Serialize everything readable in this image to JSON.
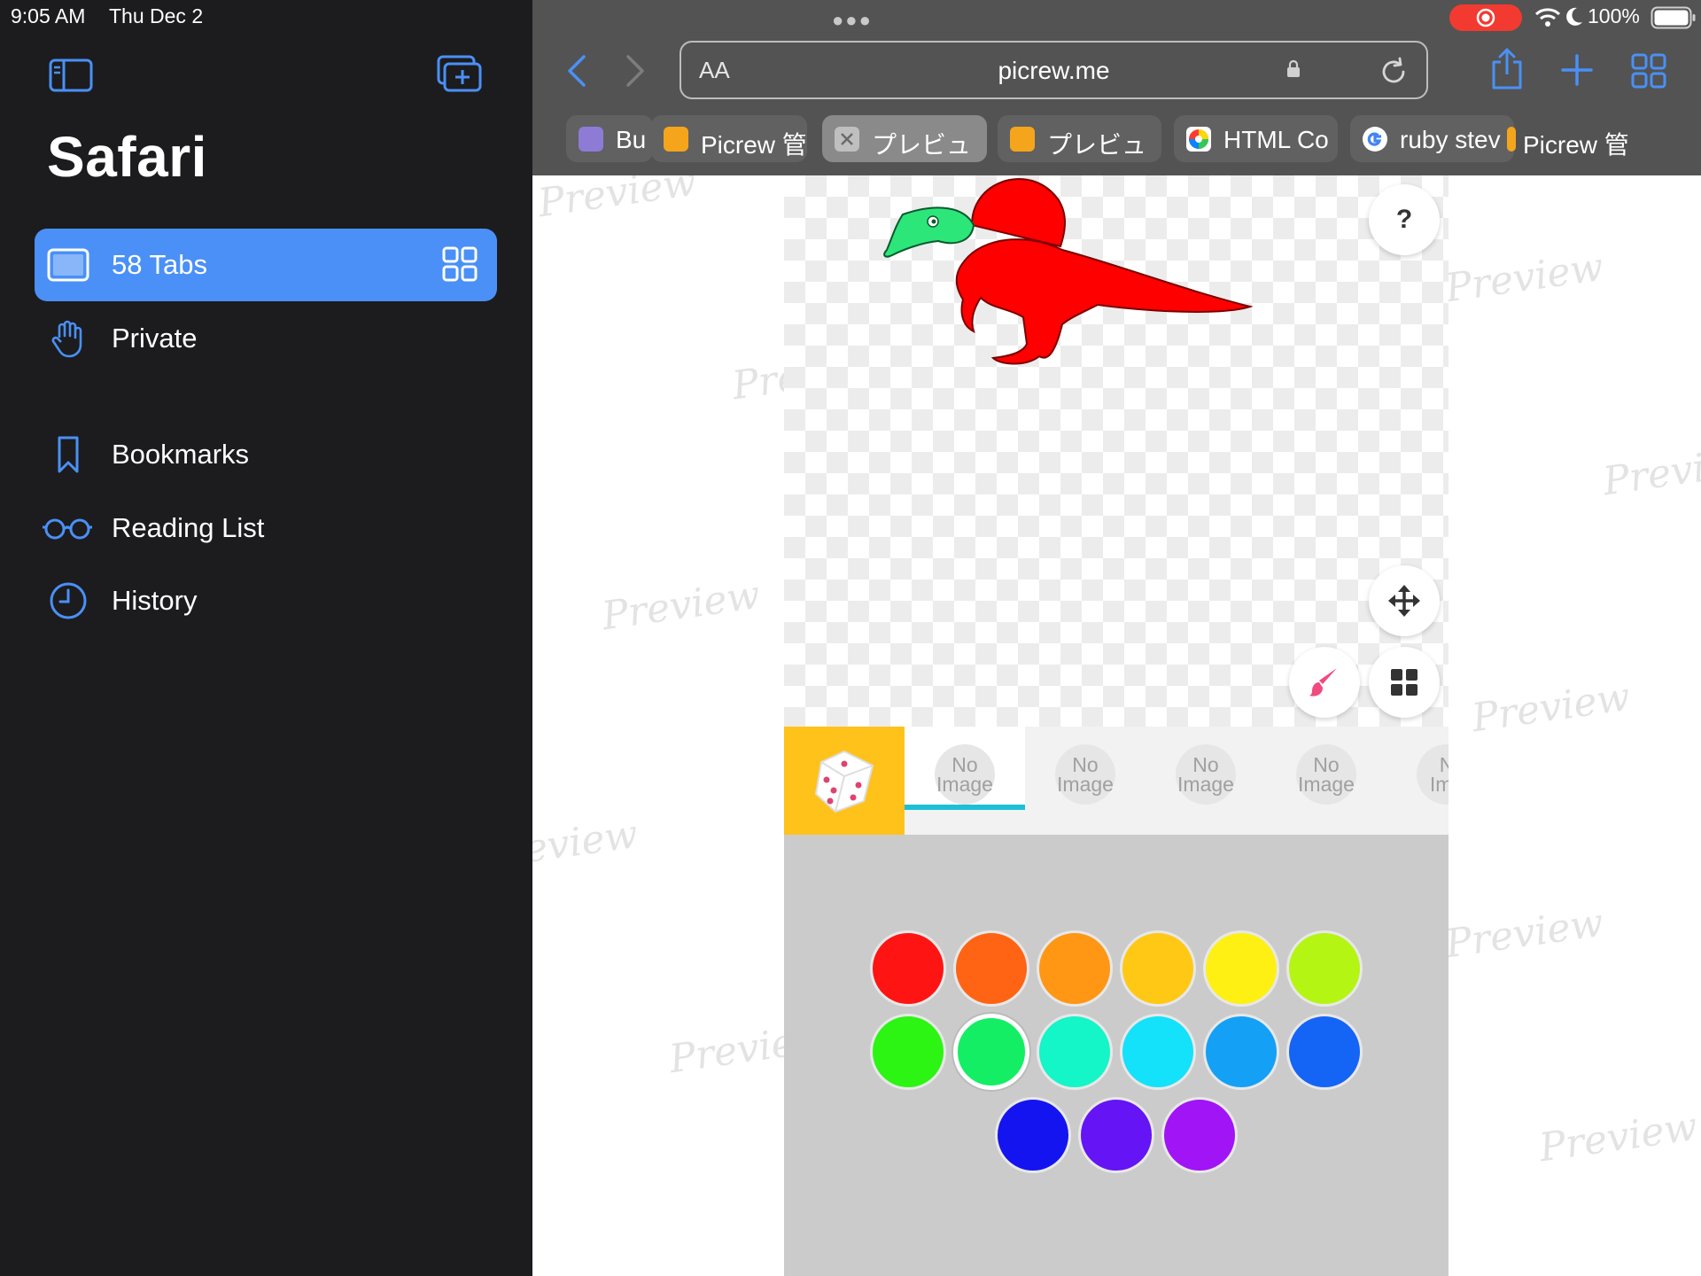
{
  "status_bar": {
    "time": "9:05 AM",
    "date": "Thu Dec 2",
    "battery": "100%"
  },
  "sidebar": {
    "title": "Safari",
    "items": [
      {
        "label": "58 Tabs",
        "active": true
      },
      {
        "label": "Private"
      },
      {
        "label": "Bookmarks"
      },
      {
        "label": "Reading List"
      },
      {
        "label": "History"
      }
    ]
  },
  "toolbar": {
    "aa_label": "AA",
    "url": "picrew.me"
  },
  "tabs": [
    {
      "label": "Bu",
      "favicon_color": "#8d7bd6"
    },
    {
      "label": "Picrew 管",
      "favicon_color": "#f5a51c"
    },
    {
      "label": "プレビュ",
      "favicon_color": "#bfbfbf",
      "active": true
    },
    {
      "label": "プレビュ",
      "favicon_color": "#f5a51c"
    },
    {
      "label": "HTML Co",
      "favicon_color": "#ffffff"
    },
    {
      "label": "ruby stev",
      "favicon_color": "#ffffff"
    },
    {
      "label": "Picrew 管",
      "favicon_color": "#f5a51c"
    }
  ],
  "watermark": "Preview",
  "maker": {
    "help_label": "?",
    "parts": [
      {
        "label_line1": "No",
        "label_line2": "Image"
      },
      {
        "label_line1": "No",
        "label_line2": "Image"
      },
      {
        "label_line1": "No",
        "label_line2": "Image"
      },
      {
        "label_line1": "No",
        "label_line2": "Image"
      },
      {
        "label_line1": "N",
        "label_line2": "Ima"
      }
    ],
    "palette": [
      "#ff1414",
      "#ff6414",
      "#ff9614",
      "#ffc814",
      "#fff014",
      "#b4f514",
      "#2cf514",
      "#14ee64",
      "#14f5c8",
      "#14e1fa",
      "#14a0f5",
      "#1464f5",
      "#1414f0",
      "#6414f5",
      "#a014f5"
    ],
    "selected_color_index": 7,
    "accent_color": "#ffc21a",
    "creature_color": "#ff0000",
    "creature_head_color": "#2ce67a"
  }
}
